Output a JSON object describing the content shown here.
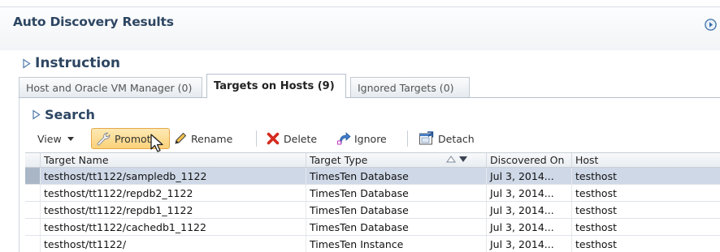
{
  "header": {
    "title": "Auto Discovery Results"
  },
  "instruction": {
    "label": "Instruction"
  },
  "tabs": [
    {
      "label": "Host and Oracle VM Manager (0)",
      "active": false
    },
    {
      "label": "Targets on Hosts (9)",
      "active": true
    },
    {
      "label": "Ignored Targets (0)",
      "active": false
    }
  ],
  "search": {
    "label": "Search"
  },
  "toolbar": {
    "view_label": "View",
    "promote_label": "Promote",
    "rename_label": "Rename",
    "delete_label": "Delete",
    "ignore_label": "Ignore",
    "detach_label": "Detach"
  },
  "table": {
    "columns": [
      "Target Name",
      "Target Type",
      "Discovered On",
      "Host"
    ],
    "rows": [
      {
        "name": "testhost/tt1122/sampledb_1122",
        "type": "TimesTen Database",
        "discovered": "Jul 3, 2014...",
        "host": "testhost",
        "selected": true
      },
      {
        "name": "testhost/tt1122/repdb2_1122",
        "type": "TimesTen Database",
        "discovered": "Jul 3, 2014...",
        "host": "testhost",
        "selected": false
      },
      {
        "name": "testhost/tt1122/repdb1_1122",
        "type": "TimesTen Database",
        "discovered": "Jul 3, 2014...",
        "host": "testhost",
        "selected": false
      },
      {
        "name": "testhost/tt1122/cachedb1_1122",
        "type": "TimesTen Database",
        "discovered": "Jul 3, 2014...",
        "host": "testhost",
        "selected": false
      },
      {
        "name": "testhost/tt1122/",
        "type": "TimesTen Instance",
        "discovered": "Jul 3, 2014...",
        "host": "testhost",
        "selected": false
      }
    ]
  },
  "colors": {
    "title": "#2d4662",
    "selected_row": "#cfd8e7",
    "promote_bg": "#fbd27a"
  }
}
